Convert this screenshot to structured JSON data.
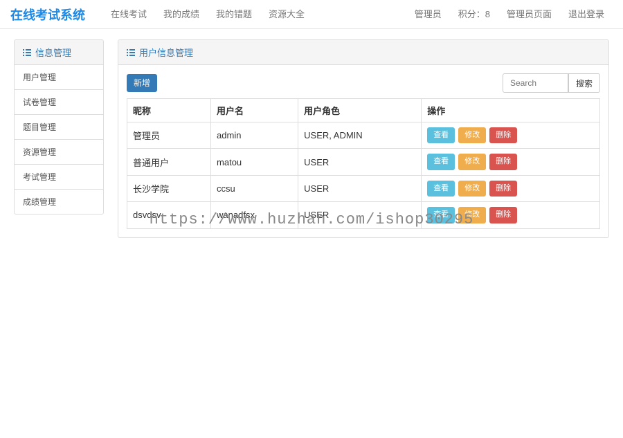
{
  "brand": "在线考试系统",
  "nav": {
    "left": [
      "在线考试",
      "我的成绩",
      "我的错题",
      "资源大全"
    ],
    "right_user": "管理员",
    "points_label": "积分：",
    "points_value": "8",
    "admin_page": "管理员页面",
    "logout": "退出登录"
  },
  "sidebar": {
    "title": "信息管理",
    "items": [
      "用户管理",
      "试卷管理",
      "题目管理",
      "资源管理",
      "考试管理",
      "成绩管理"
    ]
  },
  "main_panel": {
    "title": "用户信息管理",
    "add_btn": "新增",
    "search_placeholder": "Search",
    "search_btn": "搜索"
  },
  "table": {
    "headers": [
      "昵称",
      "用户名",
      "用户角色",
      "操作"
    ],
    "rows": [
      {
        "nick": "管理员",
        "user": "admin",
        "role": "USER, ADMIN"
      },
      {
        "nick": "普通用户",
        "user": "matou",
        "role": "USER"
      },
      {
        "nick": "长沙学院",
        "user": "ccsu",
        "role": "USER"
      },
      {
        "nick": "dsvdsv",
        "user": "wanadfsx",
        "role": "USER"
      }
    ],
    "actions": {
      "view": "查看",
      "edit": "修改",
      "delete": "删除"
    }
  },
  "watermark": "https://www.huzhan.com/ishop30295"
}
